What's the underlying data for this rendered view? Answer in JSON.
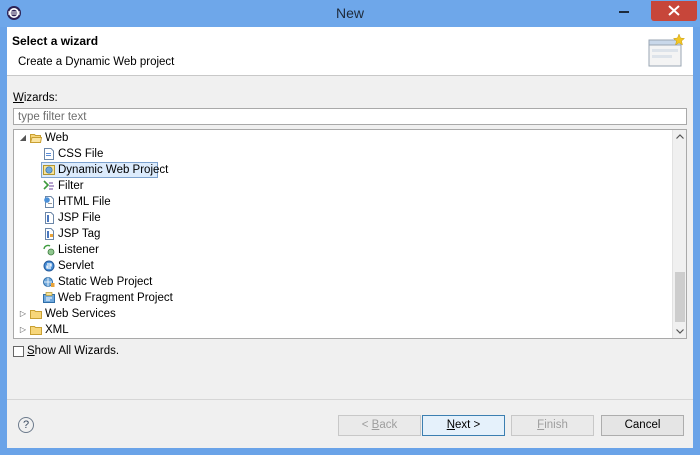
{
  "window": {
    "title": "New"
  },
  "header": {
    "title": "Select a wizard",
    "description": "Create a Dynamic Web project"
  },
  "wizards": {
    "label_prefix": "W",
    "label_rest": "izards:",
    "filter_placeholder": "type filter text"
  },
  "tree": {
    "web": "Web",
    "items": [
      {
        "label": "CSS File",
        "icon": "css-file-icon"
      },
      {
        "label": "Dynamic Web Project",
        "icon": "dynamic-web-project-icon",
        "selected": true
      },
      {
        "label": "Filter",
        "icon": "filter-icon"
      },
      {
        "label": "HTML File",
        "icon": "html-file-icon"
      },
      {
        "label": "JSP File",
        "icon": "jsp-file-icon"
      },
      {
        "label": "JSP Tag",
        "icon": "jsp-tag-icon"
      },
      {
        "label": "Listener",
        "icon": "listener-icon"
      },
      {
        "label": "Servlet",
        "icon": "servlet-icon"
      },
      {
        "label": "Static Web Project",
        "icon": "static-web-project-icon"
      },
      {
        "label": "Web Fragment Project",
        "icon": "web-fragment-project-icon"
      }
    ],
    "web_services": "Web Services",
    "xml": "XML"
  },
  "show_all": {
    "label_prefix": "S",
    "label_rest": "how All Wizards.",
    "checked": false
  },
  "buttons": {
    "back_prefix": "< ",
    "back_u": "B",
    "back_rest": "ack",
    "next_u": "N",
    "next_rest": "ext >",
    "finish_u": "F",
    "finish_rest": "inish",
    "cancel": "Cancel"
  },
  "colors": {
    "titlebar": "#6ea7ea",
    "close": "#c7463a",
    "selection": "#dcebfc"
  }
}
